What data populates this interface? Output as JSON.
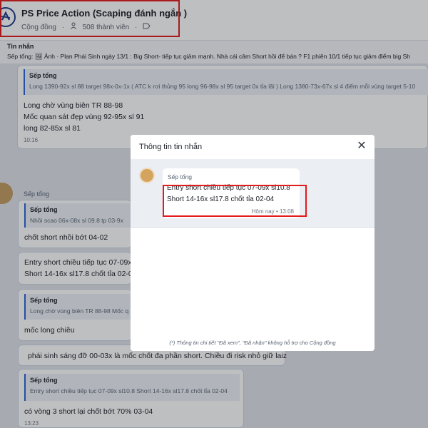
{
  "header": {
    "group_name": "PS Price Action (Scaping đánh ngắn )",
    "group_type": "Cộng đồng",
    "member_count": "508 thành viên",
    "accent_color": "#e21b1b"
  },
  "pinned": {
    "title": "Tin nhắn",
    "text": "Sếp tổng: 🖼 Ảnh · Plan Phái Sinh ngày 13/1 : Big Short- tiếp tục giảm mạnh. Nhà cái câm Short hồi để bán ?  F1 phiên 10/1 tiếp tục giảm điểm big Sh"
  },
  "messages": [
    {
      "quote_name": "Sếp tổng",
      "quote_text": "Long 1390-92x sl 88 target 98x-0x-1x ( ATC k rơi thủng 95 long 96-98x sl 95 target 0x tỉa lãi ) Long 1380-73x-67x sl 4 điểm mỗi vùng target 5-10",
      "lines": [
        "Long chờ vùng biên TR 88-98",
        "Mốc quan sát đẹp vùng 92-95x sl 91",
        "long 82-85x sl 81"
      ],
      "time": "10:16"
    },
    {
      "sender": "Sếp tổng",
      "quote_name": "Sếp tổng",
      "quote_text": "Nhồi scaо 06x-08x sl 09.8 tp 03-9x",
      "line": "chốt short nhồi bớt 04-02"
    },
    {
      "lines": [
        "Entry short chiều tiếp tục 07-09x",
        "Short 14-16x sl17.8 chốt tỉa 02-04"
      ]
    },
    {
      "quote_name": "Sếp tổng",
      "quote_text": "Long chờ vùng biên TR 88-98 Mốc q",
      "line": "mốc long chiều"
    },
    {
      "line": "phái sinh sáng đỡ 00-03x là mốc chốt đa phần short. Chiều đi risk nhỏ giữ laiz"
    },
    {
      "quote_name": "Sếp tổng",
      "quote_text": "Entry short chiều tiếp tục 07-09x sl10.8 Short 14-16x sl17.8 chốt tỉa 02-04",
      "line": "có vòng 3 short lại chốt bớt 70% 03-04",
      "time": "13:23"
    }
  ],
  "modal": {
    "title": "Thông tin tin nhắn",
    "sender": "Sếp tổng",
    "line1": "Entry short chiều tiếp tục 07-09x sl10.8",
    "line2": "Short 14-16x sl17.8 chốt tỉa 02-04",
    "time": "Hôm nay • 13:08",
    "footnote": "(*) Thông tin chi tiết \"Đã xem\", \"Đã nhận\" không hỗ trợ cho Cộng đồng",
    "close_glyph": "✕"
  }
}
